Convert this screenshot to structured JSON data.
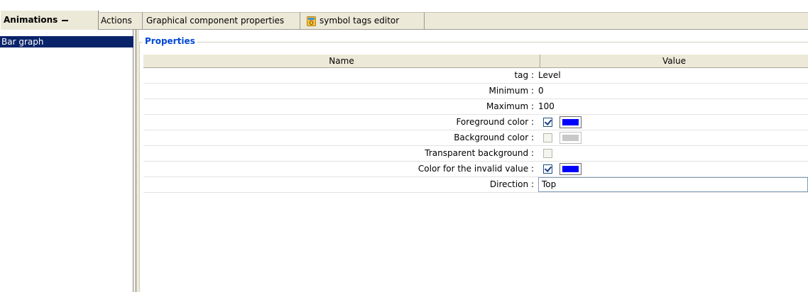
{
  "tabs": [
    {
      "label": "Animations",
      "active": true
    },
    {
      "label": "Actions",
      "active": false
    },
    {
      "label": "Graphical component properties",
      "active": false
    },
    {
      "label": "symbol tags editor",
      "active": false,
      "icon": "database-icon"
    }
  ],
  "left_list": {
    "items": [
      {
        "label": "Bar graph",
        "selected": true
      }
    ]
  },
  "properties": {
    "title": "Properties",
    "columns": {
      "name": "Name",
      "value": "Value"
    },
    "rows": [
      {
        "name": "tag :",
        "value": "Level"
      },
      {
        "name": "Minimum :",
        "value": "0"
      },
      {
        "name": "Maximum :",
        "value": "100"
      },
      {
        "name": "Foreground color :",
        "checked": true,
        "color": "#0000ff"
      },
      {
        "name": "Background color :",
        "checked": false,
        "color": "#c8c8c8"
      },
      {
        "name": "Transparent background :",
        "checked": false
      },
      {
        "name": "Color for the invalid value :",
        "checked": true,
        "color": "#0000ff"
      },
      {
        "name": "Direction :",
        "value": "Top"
      }
    ]
  },
  "colors": {
    "selection": "#0a246a",
    "group_title": "#0046d5",
    "tab_face": "#ece9d8"
  }
}
